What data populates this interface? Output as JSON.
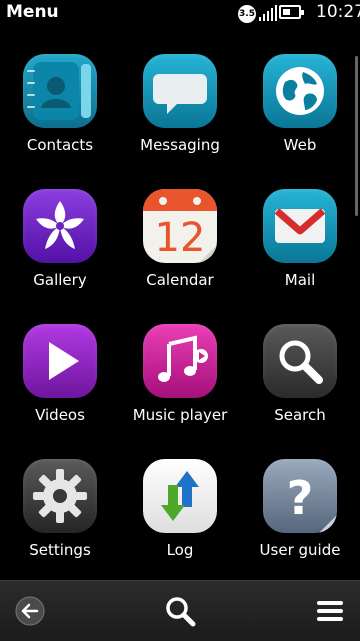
{
  "status": {
    "title": "Menu",
    "network_badge": "3.5",
    "time": "10:27",
    "battery_level": 0.45
  },
  "apps": [
    {
      "label": "Contacts",
      "icon": "contacts-icon"
    },
    {
      "label": "Messaging",
      "icon": "messaging-icon"
    },
    {
      "label": "Web",
      "icon": "web-icon"
    },
    {
      "label": "Gallery",
      "icon": "gallery-icon"
    },
    {
      "label": "Calendar",
      "icon": "calendar-icon",
      "date": "12"
    },
    {
      "label": "Mail",
      "icon": "mail-icon"
    },
    {
      "label": "Videos",
      "icon": "videos-icon"
    },
    {
      "label": "Music player",
      "icon": "music-icon"
    },
    {
      "label": "Search",
      "icon": "search-icon"
    },
    {
      "label": "Settings",
      "icon": "settings-icon"
    },
    {
      "label": "Log",
      "icon": "log-icon"
    },
    {
      "label": "User guide",
      "icon": "user-guide-icon"
    }
  ],
  "toolbar": {
    "back_icon": "back-arrow-icon",
    "search_icon": "search-icon",
    "menu_icon": "menu-icon"
  },
  "colors": {
    "background": "#000000",
    "toolbar": "#222222"
  }
}
